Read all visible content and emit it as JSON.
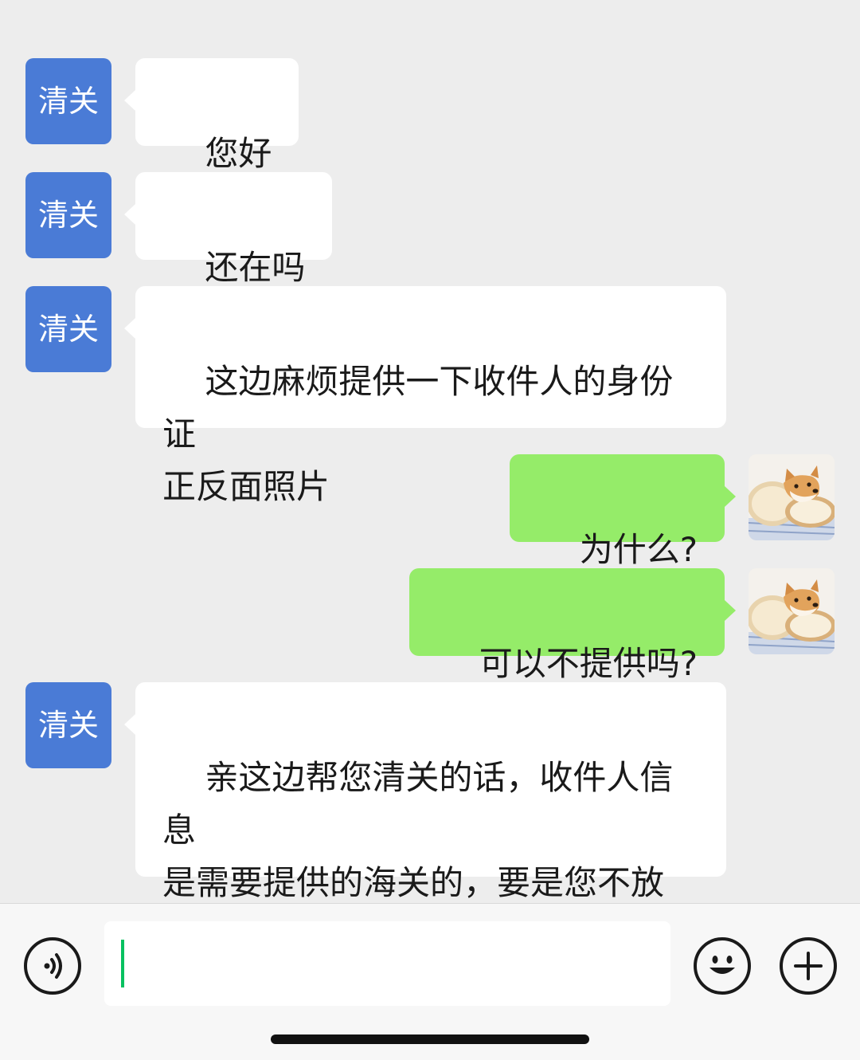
{
  "conversation": {
    "contact_name": "清关",
    "messages": [
      {
        "side": "in",
        "sender": "清关",
        "text": "您好"
      },
      {
        "side": "in",
        "sender": "清关",
        "text": "还在吗"
      },
      {
        "side": "in",
        "sender": "清关",
        "text": "这边麻烦提供一下收件人的身份证\n正反面照片"
      },
      {
        "side": "out",
        "avatar": "shiba-dog-on-bread-avatar",
        "text": "为什么?"
      },
      {
        "side": "out",
        "avatar": "shiba-dog-on-bread-avatar",
        "text": "可以不提供吗?"
      },
      {
        "side": "in",
        "sender": "清关",
        "text": "亲这边帮您清关的话，收件人信息\n是需要提供的海关的，要是您不放\n心可以家水印"
      }
    ]
  },
  "input_bar": {
    "voice_icon": "voice-icon",
    "text_value": "",
    "emoji_icon": "emoji-icon",
    "more_icon": "plus-icon"
  },
  "colors": {
    "background": "#ededed",
    "incoming_bubble": "#ffffff",
    "outgoing_bubble": "#95ec69",
    "contact_avatar": "#4a7bd6",
    "caret": "#07c160"
  }
}
